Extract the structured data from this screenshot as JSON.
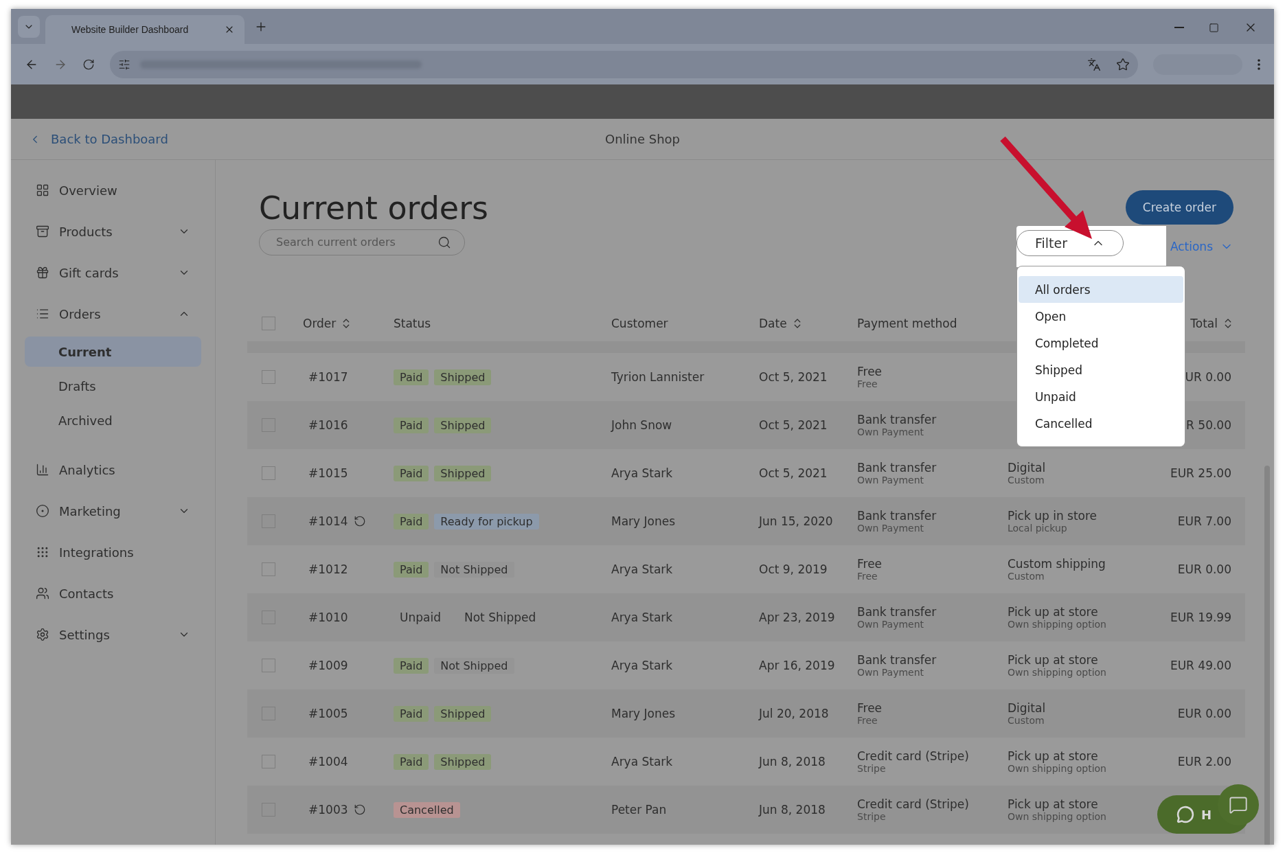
{
  "browser": {
    "tab_title": "Website Builder Dashboard"
  },
  "header": {
    "back_link": "Back to Dashboard",
    "title": "Online Shop"
  },
  "sidebar": {
    "items": [
      {
        "label": "Overview"
      },
      {
        "label": "Products",
        "expanded": false
      },
      {
        "label": "Gift cards",
        "expanded": false
      },
      {
        "label": "Orders",
        "expanded": true,
        "children": [
          {
            "label": "Current",
            "selected": true
          },
          {
            "label": "Drafts",
            "selected": false
          },
          {
            "label": "Archived",
            "selected": false
          }
        ]
      },
      {
        "label": "Analytics"
      },
      {
        "label": "Marketing",
        "expanded": false
      },
      {
        "label": "Integrations"
      },
      {
        "label": "Contacts"
      },
      {
        "label": "Settings",
        "expanded": false
      }
    ]
  },
  "page": {
    "title": "Current orders",
    "search": {
      "placeholder": "Search current orders"
    },
    "create_button": "Create order",
    "filter": {
      "label": "Filter",
      "open": true
    },
    "actions": "Actions",
    "filter_options": [
      {
        "label": "All orders",
        "selected": true
      },
      {
        "label": "Open",
        "selected": false
      },
      {
        "label": "Completed",
        "selected": false
      },
      {
        "label": "Shipped",
        "selected": false
      },
      {
        "label": "Unpaid",
        "selected": false
      },
      {
        "label": "Cancelled",
        "selected": false
      }
    ]
  },
  "table": {
    "select_all_checked": false,
    "columns": [
      {
        "label": "Order",
        "sortable": true
      },
      {
        "label": "Status",
        "sortable": false
      },
      {
        "label": "Customer",
        "sortable": false
      },
      {
        "label": "Date",
        "sortable": true
      },
      {
        "label": "Payment method",
        "sortable": false
      },
      {
        "label": "Total",
        "sortable": true
      }
    ],
    "rows": [
      {
        "order": "#1017",
        "checked": false,
        "refund": false,
        "badges": [
          {
            "label": "Paid",
            "color": "#8b9a78"
          },
          {
            "label": "Shipped",
            "color": "#8b9a78"
          }
        ],
        "customer": "Tyrion Lannister",
        "date": "Oct 5, 2021",
        "payment": "Free",
        "payment_sub": "Free",
        "total": "UR 0.00"
      },
      {
        "order": "#1016",
        "checked": false,
        "refund": false,
        "badges": [
          {
            "label": "Paid",
            "color": "#8b9a78"
          },
          {
            "label": "Shipped",
            "color": "#8b9a78"
          }
        ],
        "customer": "John Snow",
        "date": "Oct 5, 2021",
        "payment": "Bank transfer",
        "payment_sub": "Own Payment",
        "total": "R 50.00"
      },
      {
        "order": "#1015",
        "checked": false,
        "refund": false,
        "badges": [
          {
            "label": "Paid",
            "color": "#8b9a78"
          },
          {
            "label": "Shipped",
            "color": "#8b9a78"
          }
        ],
        "customer": "Arya Stark",
        "date": "Oct 5, 2021",
        "payment": "Bank transfer",
        "payment_sub": "Own Payment",
        "shipping": "Digital",
        "shipping_sub": "Custom",
        "total": "EUR 25.00"
      },
      {
        "order": "#1014",
        "checked": false,
        "refund": true,
        "badges": [
          {
            "label": "Paid",
            "color": "#8b9a78"
          },
          {
            "label": "Ready for pickup",
            "color": "#8c9aab"
          }
        ],
        "customer": "Mary Jones",
        "date": "Jun 15, 2020",
        "payment": "Bank transfer",
        "payment_sub": "Own Payment",
        "shipping": "Pick up in store",
        "shipping_sub": "Local pickup",
        "total": "EUR 7.00"
      },
      {
        "order": "#1012",
        "checked": false,
        "refund": false,
        "badges": [
          {
            "label": "Paid",
            "color": "#8b9a78"
          },
          {
            "label": "Not Shipped",
            "color": "#959595"
          }
        ],
        "customer": "Arya Stark",
        "date": "Oct 9, 2019",
        "payment": "Free",
        "payment_sub": "Free",
        "shipping": "Custom shipping",
        "shipping_sub": "Custom",
        "total": "EUR 0.00"
      },
      {
        "order": "#1010",
        "checked": false,
        "refund": false,
        "badges": [
          {
            "label": "Unpaid"
          },
          {
            "label": "Not Shipped"
          }
        ],
        "customer": "Arya Stark",
        "date": "Apr 23, 2019",
        "payment": "Bank transfer",
        "payment_sub": "Own Payment",
        "shipping": "Pick up at store",
        "shipping_sub": "Own shipping option",
        "total": "EUR 19.99"
      },
      {
        "order": "#1009",
        "checked": false,
        "refund": false,
        "badges": [
          {
            "label": "Paid",
            "color": "#8b9a78"
          },
          {
            "label": "Not Shipped",
            "color": "#959595"
          }
        ],
        "customer": "Arya Stark",
        "date": "Apr 16, 2019",
        "payment": "Bank transfer",
        "payment_sub": "Own Payment",
        "shipping": "Pick up at store",
        "shipping_sub": "Own shipping option",
        "total": "EUR 49.00"
      },
      {
        "order": "#1005",
        "checked": false,
        "refund": false,
        "badges": [
          {
            "label": "Paid",
            "color": "#8b9a78"
          },
          {
            "label": "Shipped",
            "color": "#8b9a78"
          }
        ],
        "customer": "Mary Jones",
        "date": "Jul 20, 2018",
        "payment": "Free",
        "payment_sub": "Free",
        "shipping": "Digital",
        "shipping_sub": "Custom",
        "total": "EUR 0.00"
      },
      {
        "order": "#1004",
        "checked": false,
        "refund": false,
        "badges": [
          {
            "label": "Paid",
            "color": "#8b9a78"
          },
          {
            "label": "Shipped",
            "color": "#8b9a78"
          }
        ],
        "customer": "Arya Stark",
        "date": "Jun 8, 2018",
        "payment": "Credit card (Stripe)",
        "payment_sub": "Stripe",
        "shipping": "Pick up at store",
        "shipping_sub": "Own shipping option",
        "total": "EUR 2.00"
      },
      {
        "order": "#1003",
        "checked": false,
        "refund": true,
        "badges": [
          {
            "label": "Cancelled",
            "color": "#b89392"
          }
        ],
        "customer": "Peter Pan",
        "date": "Jun 8, 2018",
        "payment": "Credit card (Stripe)",
        "payment_sub": "Stripe",
        "shipping": "Pick up at store",
        "shipping_sub": "Own shipping option"
      }
    ]
  },
  "chat": {
    "label": "H"
  }
}
